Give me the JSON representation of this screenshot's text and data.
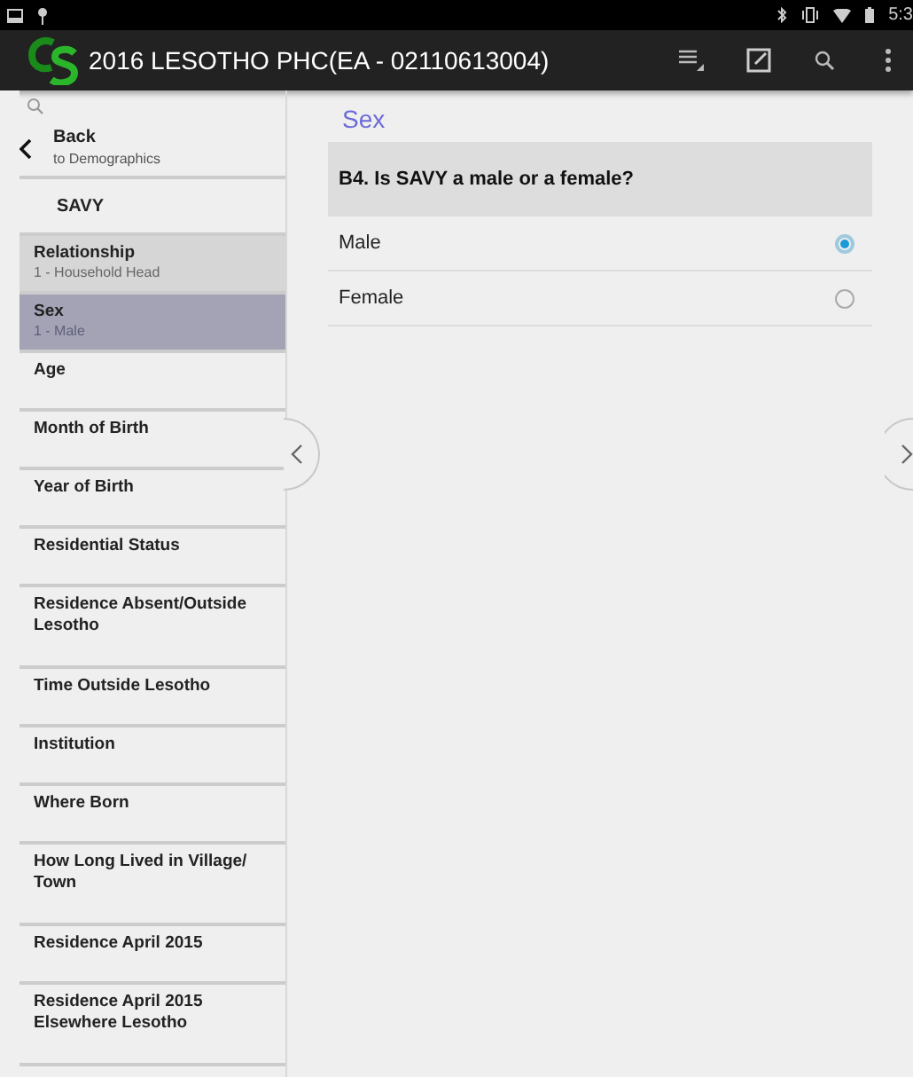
{
  "status_bar": {
    "time": "5:3"
  },
  "app_bar": {
    "title": "2016 LESOTHO PHC(EA - 02110613004)"
  },
  "sidebar": {
    "back": {
      "label": "Back",
      "sublabel": "to Demographics"
    },
    "items": [
      {
        "kind": "section",
        "label": "SAVY",
        "selected": false
      },
      {
        "kind": "question",
        "label": "Relationship",
        "value": "1 - Household Head",
        "selected": false
      },
      {
        "kind": "question",
        "label": "Sex",
        "value": "1 - Male",
        "selected": true
      },
      {
        "kind": "question",
        "label": "Age",
        "selected": false
      },
      {
        "kind": "question",
        "label": "Month of Birth",
        "selected": false
      },
      {
        "kind": "question",
        "label": "Year of  Birth",
        "selected": false
      },
      {
        "kind": "question",
        "label": "Residential Status",
        "selected": false
      },
      {
        "kind": "question",
        "label": "Residence Absent/Outside Lesotho",
        "selected": false
      },
      {
        "kind": "question",
        "label": "Time Outside Lesotho",
        "selected": false
      },
      {
        "kind": "question",
        "label": "Institution",
        "selected": false
      },
      {
        "kind": "question",
        "label": "Where Born",
        "selected": false
      },
      {
        "kind": "question",
        "label": "How Long Lived in Village/ Town",
        "selected": false
      },
      {
        "kind": "question",
        "label": "Residence April 2015",
        "selected": false
      },
      {
        "kind": "question",
        "label": "Residence April 2015 Elsewhere Lesotho",
        "selected": false
      }
    ]
  },
  "question": {
    "title": "Sex",
    "text": "B4. Is SAVY a male or a female?",
    "options": [
      {
        "label": "Male",
        "selected": true
      },
      {
        "label": "Female",
        "selected": false
      }
    ]
  }
}
